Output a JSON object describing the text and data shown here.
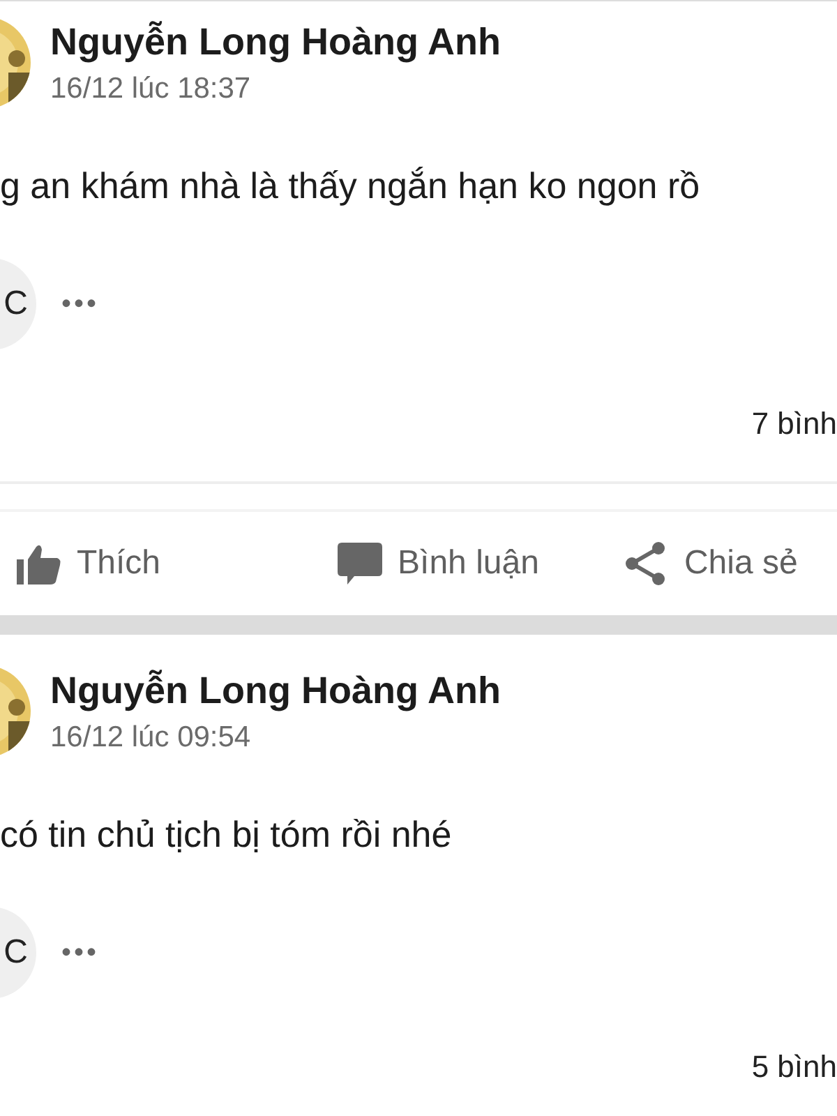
{
  "posts": [
    {
      "author": "Nguyễn Long Hoàng Anh",
      "time": "16/12 lúc 18:37",
      "text": "g an khám nhà là thấy ngắn hạn ko ngon rồ",
      "comment_preview": {
        "avatar_letter": "C",
        "more": "•••"
      },
      "comment_count": "7 bình",
      "actions": [
        {
          "kind": "like",
          "label": "Thích"
        },
        {
          "kind": "comment",
          "label": "Bình luận"
        },
        {
          "kind": "share",
          "label": "Chia sẻ"
        }
      ]
    },
    {
      "author": "Nguyễn Long Hoàng Anh",
      "time": "16/12 lúc 09:54",
      "text": "có tin chủ tịch bị tóm rồi nhé",
      "comment_preview": {
        "avatar_letter": "C",
        "more": "•••"
      },
      "comment_count": "5 bình"
    }
  ]
}
